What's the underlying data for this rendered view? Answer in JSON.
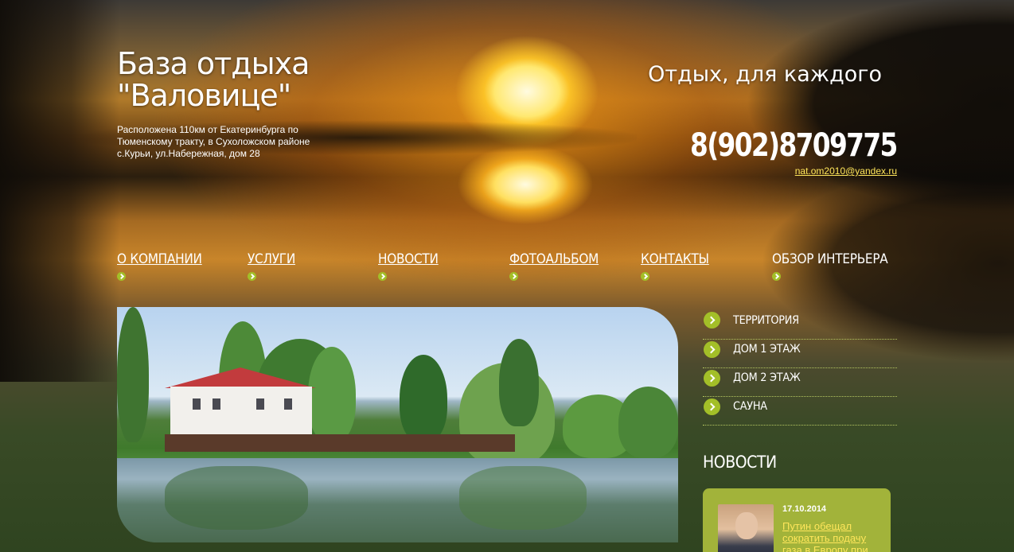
{
  "header": {
    "title_line1": "База отдыха",
    "title_line2": "\"Валовице\"",
    "description": "Расположена 110км от Екатеринбурга по Тюменскому тракту, в Сухоложском районе с.Курьи, ул.Набережная, дом 28",
    "slogan": "Отдых, для каждого",
    "phone": "8(902)8709775",
    "email": "nat.om2010@yandex.ru"
  },
  "nav": {
    "items": [
      {
        "label": "О КОМПАНИИ",
        "active": false
      },
      {
        "label": "УСЛУГИ",
        "active": false
      },
      {
        "label": "НОВОСТИ",
        "active": false
      },
      {
        "label": "ФОТОАЛЬБОМ",
        "active": false
      },
      {
        "label": "КОНТАКТЫ",
        "active": false
      },
      {
        "label": "ОБЗОР ИНТЕРЬЕРА",
        "active": true
      }
    ]
  },
  "submenu": {
    "items": [
      {
        "label": "ТЕРРИТОРИЯ"
      },
      {
        "label": "ДОМ 1 ЭТАЖ"
      },
      {
        "label": "ДОМ 2 ЭТАЖ"
      },
      {
        "label": "САУНА"
      }
    ]
  },
  "news": {
    "heading": "НОВОСТИ",
    "items": [
      {
        "date": "17.10.2014",
        "title": "Путин обещал сократить подачу газа в Европу при"
      }
    ]
  },
  "colors": {
    "accent_green": "#a3bf28",
    "link_yellow": "#ffe65a",
    "news_card": "#a2b33a"
  }
}
